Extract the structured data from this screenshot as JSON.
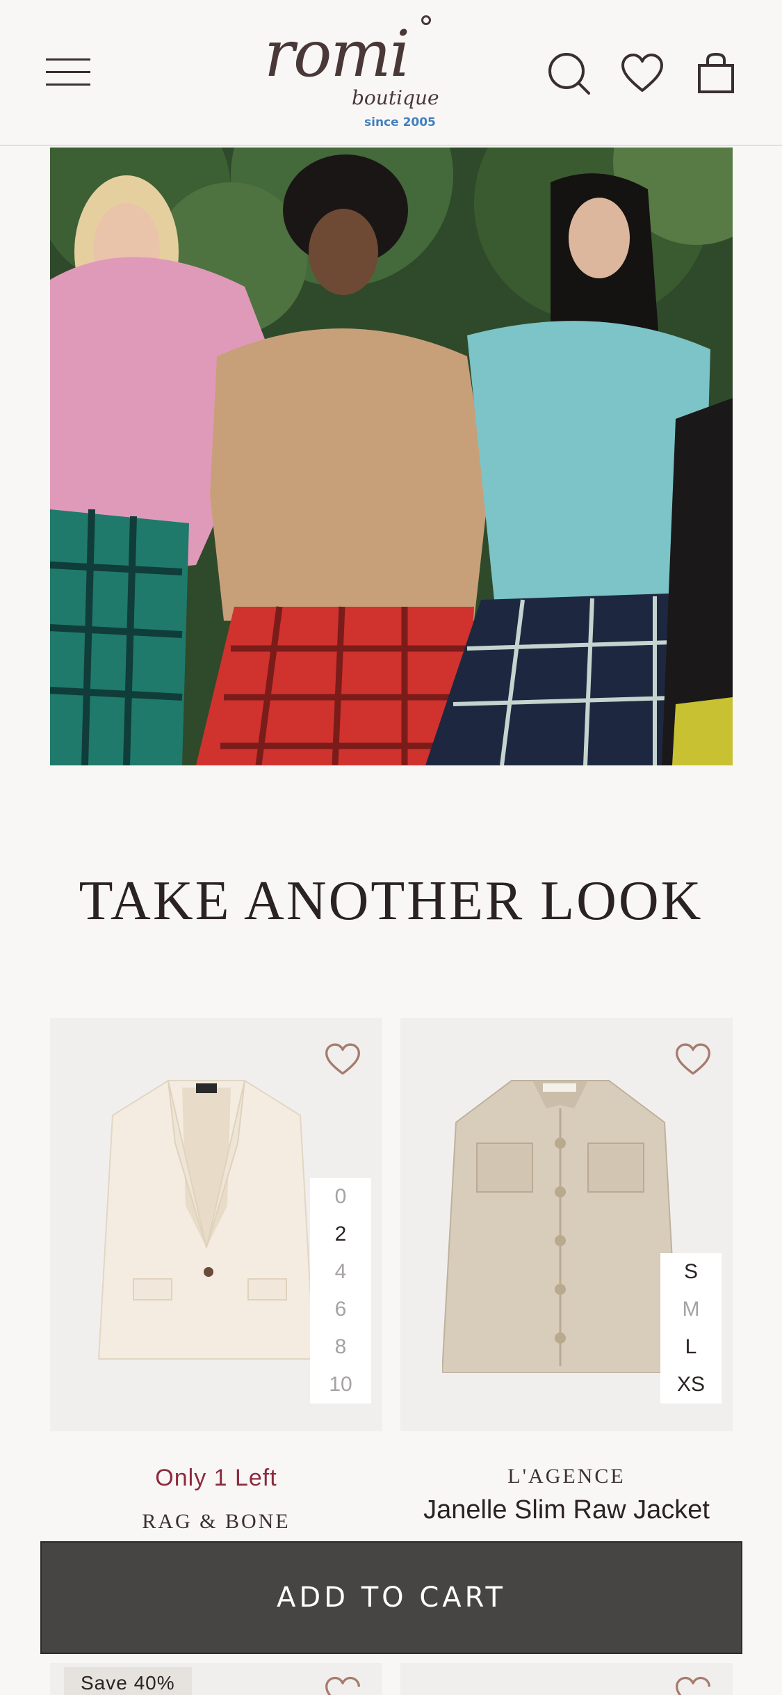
{
  "header": {
    "logo_word": "romi",
    "logo_sub": "boutique",
    "logo_since": "since 2005"
  },
  "hero": {
    "image_alt": "Three models wearing oversized sweaters and plaid skirts"
  },
  "section": {
    "title": "TAKE ANOTHER LOOK"
  },
  "products": [
    {
      "stock_note": "Only 1 Left",
      "brand": "RAG & BONE",
      "name": "",
      "sizes": [
        {
          "label": "0",
          "available": false
        },
        {
          "label": "2",
          "available": true
        },
        {
          "label": "4",
          "available": false
        },
        {
          "label": "6",
          "available": false
        },
        {
          "label": "8",
          "available": false
        },
        {
          "label": "10",
          "available": false
        }
      ]
    },
    {
      "stock_note": "",
      "brand": "L'AGENCE",
      "name": "Janelle Slim Raw Jacket",
      "sizes": [
        {
          "label": "S",
          "available": true
        },
        {
          "label": "M",
          "available": false
        },
        {
          "label": "L",
          "available": true
        },
        {
          "label": "XS",
          "available": true
        }
      ]
    }
  ],
  "cart": {
    "label": "ADD TO CART"
  },
  "next_row": {
    "badge": "Save 40%"
  },
  "colors": {
    "background": "#f9f7f6",
    "accent_red": "#8c2a3c",
    "cart_bar": "#474444",
    "icon_tan": "#a67c6d"
  }
}
